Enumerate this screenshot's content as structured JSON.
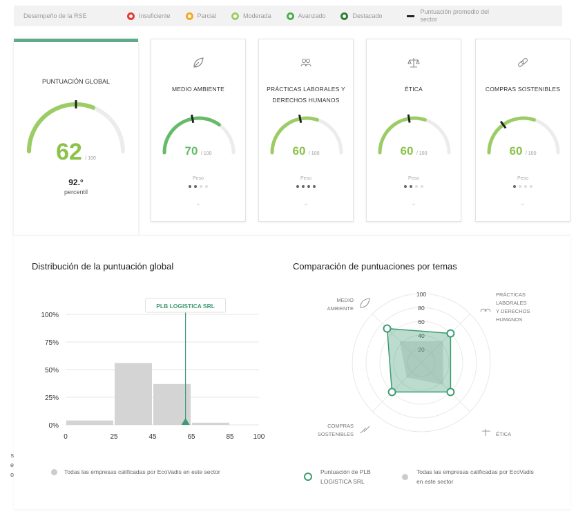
{
  "legend": {
    "title": "Desempeño de la RSE",
    "items": [
      {
        "label": "Insuficiente",
        "color": "#e53935"
      },
      {
        "label": "Parcial",
        "color": "#f5a623"
      },
      {
        "label": "Moderada",
        "color": "#9ccc65"
      },
      {
        "label": "Avanzado",
        "color": "#4caf50"
      },
      {
        "label": "Destacado",
        "color": "#2e7d32"
      }
    ],
    "average_label": "Puntuación promedio del sector"
  },
  "global": {
    "title": "PUNTUACIÓN GLOBAL",
    "score": "62",
    "max": "/ 100",
    "percentile_value": "92.°",
    "percentile_label": "percentil",
    "score_fraction": 0.62,
    "avg_fraction": 0.5
  },
  "themes": [
    {
      "title": "MEDIO AMBIENTE",
      "score": "70",
      "max": "/ 100",
      "peso": "Peso",
      "weight": 2,
      "icon": "leaf-icon",
      "color": "#66bb6a",
      "score_fraction": 0.7,
      "avg_fraction": 0.44
    },
    {
      "title": "PRÁCTICAS LABORALES Y DERECHOS HUMANOS",
      "score": "60",
      "max": "/ 100",
      "peso": "Peso",
      "weight": 4,
      "icon": "people-icon",
      "color": "#9ccc65",
      "score_fraction": 0.6,
      "avg_fraction": 0.44
    },
    {
      "title": "ÉTICA",
      "score": "60",
      "max": "/ 100",
      "peso": "Peso",
      "weight": 2,
      "icon": "scales-icon",
      "color": "#9ccc65",
      "score_fraction": 0.6,
      "avg_fraction": 0.45
    },
    {
      "title": "COMPRAS SOSTENIBLES",
      "score": "60",
      "max": "/ 100",
      "peso": "Peso",
      "weight": 1,
      "icon": "link-icon",
      "color": "#9ccc65",
      "score_fraction": 0.6,
      "avg_fraction": 0.3
    }
  ],
  "distribution": {
    "title": "Distribución de la puntuación global",
    "company_label": "PLB LOGISTICA SRL",
    "legend_label": "Todas las empresas calificadas por EcoVadis en este sector"
  },
  "comparison": {
    "title": "Comparación de puntuaciones por temas",
    "axis_labels": [
      "MEDIO AMBIENTE",
      "PRÁCTICAS LABORALES Y DERECHOS HUMANOS",
      "ÉTICA",
      "COMPRAS SOSTENIBLES"
    ],
    "legend_company": "Puntuación de PLB LOGISTICA SRL",
    "legend_all": "Todas las empresas calificadas por EcoVadis en este sector"
  },
  "side_fragment": [
    "s",
    "e",
    "o"
  ],
  "chart_data": [
    {
      "type": "bar",
      "title": "Distribución de la puntuación global",
      "categories": [
        "0-25",
        "25-45",
        "45-65",
        "65-85",
        "85-100"
      ],
      "bin_edges": [
        0,
        25,
        45,
        65,
        85,
        100
      ],
      "x_ticks": [
        "0",
        "25",
        "45",
        "65",
        "85",
        "100"
      ],
      "y_ticks": [
        "100%",
        "75%",
        "50%",
        "25%",
        "0%"
      ],
      "values": [
        4,
        56,
        37,
        2,
        0
      ],
      "ylim": [
        0,
        100
      ],
      "marker": {
        "label": "PLB LOGISTICA SRL",
        "x": 62
      },
      "grid": true
    },
    {
      "type": "radar",
      "title": "Comparación de puntuaciones por temas",
      "axes": [
        "MEDIO AMBIENTE",
        "PRÁCTICAS LABORALES Y DERECHOS HUMANOS",
        "ÉTICA",
        "COMPRAS SOSTENIBLES"
      ],
      "ticks": [
        "100",
        "80",
        "60",
        "40",
        "20"
      ],
      "range": [
        0,
        100
      ],
      "series": [
        {
          "name": "Puntuación de PLB LOGISTICA SRL",
          "values": [
            70,
            60,
            60,
            60
          ],
          "color": "#3d9b73"
        },
        {
          "name": "Todas las empresas calificadas por EcoVadis en este sector",
          "values": [
            44,
            44,
            45,
            30
          ],
          "color": "#cccccc"
        }
      ]
    }
  ]
}
